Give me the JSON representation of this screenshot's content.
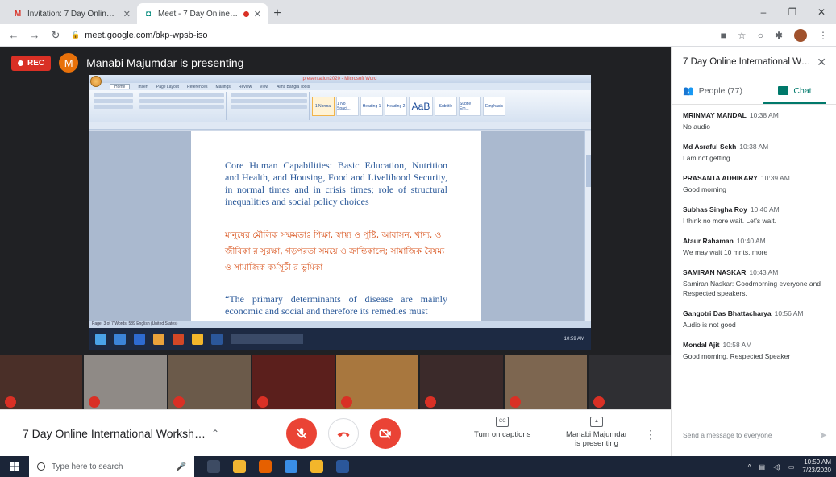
{
  "browser": {
    "tabs": [
      {
        "favicon": "M",
        "title": "Invitation: 7 Day Online Internati",
        "active": false,
        "recording": false
      },
      {
        "favicon": "◘",
        "title": "Meet - 7 Day Online Internal",
        "active": true,
        "recording": true
      }
    ],
    "url": "meet.google.com/bkp-wpsb-iso",
    "window_controls": [
      "–",
      "❐",
      "✕"
    ]
  },
  "meet": {
    "rec_label": "REC",
    "presenter_initial": "M",
    "presenter_text": "Manabi Majumdar is presenting",
    "meeting_title": "7 Day Online International Workshop o...",
    "captions_label": "Turn on captions",
    "present_label": "Manabi Majumdar is presenting",
    "cc_icon_text": "CC"
  },
  "shared_doc": {
    "window_title": "presentation2020 - Microsoft Word",
    "ribbon_tabs": [
      "Home",
      "Insert",
      "Page Layout",
      "References",
      "Mailings",
      "Review",
      "View",
      "Aims Bangla Tools"
    ],
    "styles": [
      "1 Normal",
      "1 No Spaci...",
      "Heading 1",
      "Heading 2",
      "AaB",
      "Subtitle",
      "Subtle Em...",
      "Emphasis"
    ],
    "para_english": "Core Human Capabilities: Basic Education, Nutrition and Health, and Housing, Food and Livelihood Security, in normal times and in crisis times; role of structural inequalities and social policy choices",
    "para_bengali": "মানুষের মৌলিক সক্ষমতাঃ শিক্ষা, স্বাস্থ্য ও পুষ্টি, আবাসন, খাদ্য, ও জীবিকা র সুরক্ষা, গড়পরতা সময়ে ও ক্রান্তিকালে; সামাজিক বৈষম্য ও সামাজিক কর্মসূচী র ভূমিকা",
    "para_quote": "“The primary determinants of disease are mainly economic and social and therefore its remedies must",
    "status": "Page: 3 of 7   Words: 589   English (United States)",
    "clock": "10:59 AM"
  },
  "panel": {
    "title": "7 Day Online International Works...",
    "people_tab": "People (77)",
    "chat_tab": "Chat",
    "messages": [
      {
        "sender": "MRINMAY MANDAL",
        "time": "10:38 AM",
        "text": "No audio"
      },
      {
        "sender": "Md Asraful Sekh",
        "time": "10:38 AM",
        "text": "I am not getting"
      },
      {
        "sender": "PRASANTA ADHIKARY",
        "time": "10:39 AM",
        "text": "Good morning"
      },
      {
        "sender": "Subhas Singha Roy",
        "time": "10:40 AM",
        "text": "I think no more wait. Let's wait."
      },
      {
        "sender": "Ataur Rahaman",
        "time": "10:40 AM",
        "text": "We may wait 10 mnts. more"
      },
      {
        "sender": "SAMIRAN NASKAR",
        "time": "10:43 AM",
        "text": "Samiran Naskar: Goodmorning everyone and Respected speakers."
      },
      {
        "sender": "Gangotri Das Bhattacharya",
        "time": "10:56 AM",
        "text": "Audio is not good"
      },
      {
        "sender": "Mondal Ajit",
        "time": "10:58 AM",
        "text": "Good morning, Respected Speaker"
      }
    ],
    "composer_placeholder": "Send a message to everyone"
  },
  "taskbar": {
    "search_placeholder": "Type here to search",
    "time": "10:59 AM",
    "date": "7/23/2020"
  },
  "colors": {
    "meet_red": "#ea4335",
    "chat_green": "#00796b",
    "doc_blue": "#2c5a9a",
    "doc_orange": "#d9541e"
  }
}
